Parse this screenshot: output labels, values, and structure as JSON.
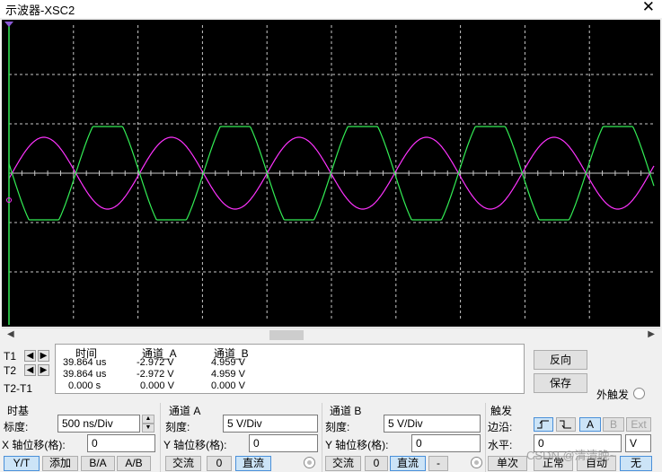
{
  "window": {
    "title": "示波器-XSC2",
    "close_glyph": "✕"
  },
  "screen": {
    "background": "#000000",
    "grid_color": "#c8c8c8",
    "channel_a_color": "#ff33ff",
    "channel_b_color": "#33ee55"
  },
  "readout": {
    "headers": {
      "time": "时间",
      "ch_a": "通道_A",
      "ch_b": "通道_B"
    },
    "rows": [
      {
        "label": "T1",
        "time": "39.864 us",
        "ch_a": "-2.972 V",
        "ch_b": "4.959 V"
      },
      {
        "label": "T2",
        "time": "39.864 us",
        "ch_a": "-2.972 V",
        "ch_b": "4.959 V"
      },
      {
        "label": "T2-T1",
        "time": "0.000 s",
        "ch_a": "0.000 V",
        "ch_b": "0.000 V"
      }
    ]
  },
  "buttons": {
    "reverse": "反向",
    "save": "保存",
    "ext_trigger": "外触发"
  },
  "timebase": {
    "title": "时基",
    "scale_label": "标度:",
    "scale_value": "500 ns/Div",
    "offset_label": "X 轴位移(格):",
    "offset_value": "0",
    "modes": [
      "Y/T",
      "添加",
      "B/A",
      "A/B"
    ]
  },
  "channel_a": {
    "title": "通道 A",
    "scale_label": "刻度:",
    "scale_value": "5  V/Div",
    "offset_label": "Y 轴位移(格):",
    "offset_value": "0",
    "coupling": [
      "交流",
      "0",
      "直流"
    ]
  },
  "channel_b": {
    "title": "通道 B",
    "scale_label": "刻度:",
    "scale_value": "5  V/Div",
    "offset_label": "Y 轴位移(格):",
    "offset_value": "0",
    "coupling": [
      "交流",
      "0",
      "直流",
      "-"
    ]
  },
  "trigger": {
    "title": "触发",
    "edge_label": "边沿:",
    "sources": [
      "A",
      "B",
      "Ext"
    ],
    "level_label": "水平:",
    "level_value": "0",
    "level_unit": "V",
    "modes": [
      "单次",
      "正常",
      "自动",
      "无"
    ]
  },
  "watermark": "CSDN @清清晚~"
}
